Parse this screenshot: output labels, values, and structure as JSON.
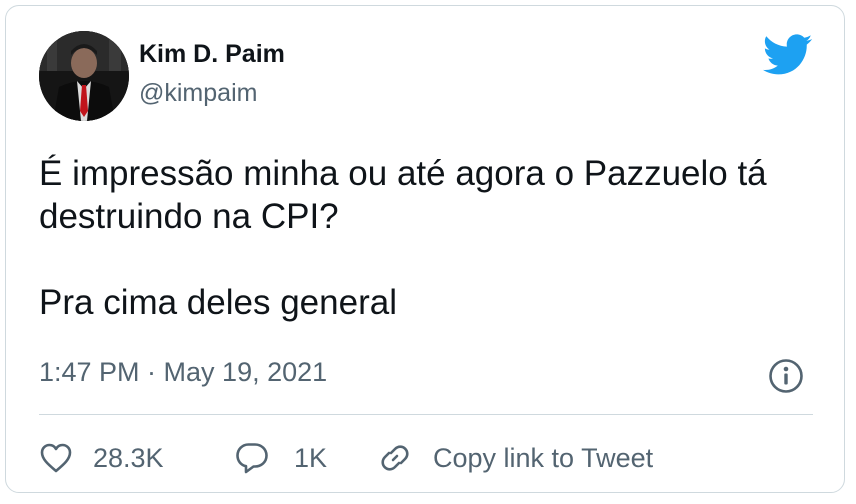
{
  "author": {
    "name": "Kim D. Paim",
    "handle": "@kimpaim"
  },
  "tweet": {
    "paragraphs": [
      "É impressão minha ou até agora o Pazzuelo tá destruindo na CPI?",
      "Pra cima deles general"
    ],
    "timestamp": "1:47 PM · May 19, 2021"
  },
  "actions": {
    "likes": "28.3K",
    "replies": "1K",
    "copy_link": "Copy link to Tweet"
  },
  "icons": {
    "brand": "twitter-bird-icon",
    "info": "info-icon",
    "like": "heart-icon",
    "reply": "reply-bubble-icon",
    "copy": "link-icon"
  },
  "colors": {
    "brand_blue": "#1da1f2",
    "text_primary": "#0f1419",
    "text_secondary": "#536471",
    "border": "#cfd9de"
  }
}
